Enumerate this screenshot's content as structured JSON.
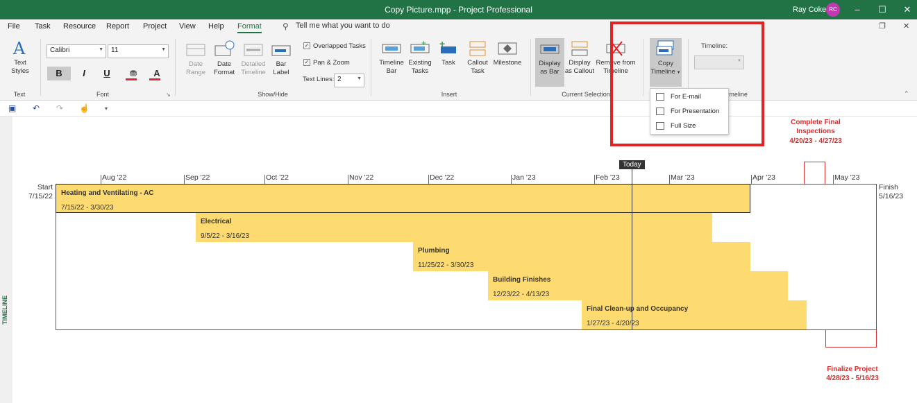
{
  "titlebar": {
    "title": "Copy Picture.mpp  -  Project Professional",
    "user": "Ray Coker",
    "avatar": "RC"
  },
  "menu": {
    "tabs": [
      "File",
      "Task",
      "Resource",
      "Report",
      "Project",
      "View",
      "Help",
      "Format"
    ],
    "active": "Format",
    "search": "Tell me what you want to do"
  },
  "ribbon": {
    "text_group": {
      "label": "Text",
      "text_styles": "Text\nStyles"
    },
    "font_group": {
      "label": "Font",
      "font": "Calibri",
      "size": "11",
      "bold": "B",
      "italic": "I",
      "underline": "U"
    },
    "showhide_group": {
      "label": "Show/Hide",
      "date_range": "Date\nRange",
      "date_format": "Date\nFormat",
      "detailed_timeline": "Detailed\nTimeline",
      "bar_label": "Bar\nLabel",
      "overlapped": "Overlapped Tasks",
      "pan_zoom": "Pan & Zoom",
      "text_lines_label": "Text Lines:",
      "text_lines_value": "2"
    },
    "insert_group": {
      "label": "Insert",
      "timeline_bar": "Timeline\nBar",
      "existing_tasks": "Existing\nTasks",
      "task": "Task",
      "callout_task": "Callout\nTask",
      "milestone": "Milestone"
    },
    "current_selection_group": {
      "label": "Current Selection",
      "display_bar": "Display\nas Bar",
      "display_callout": "Display\nas Callout",
      "remove": "Remove from\nTimeline"
    },
    "copy_group": {
      "copy_timeline": "Copy\nTimeline"
    },
    "timeline_group": {
      "label_top": "Timeline:",
      "label_bottom": "Timeline"
    }
  },
  "dropdown": {
    "items": [
      "For E-mail",
      "For Presentation",
      "Full Size"
    ]
  },
  "sidebar": {
    "label": "TIMELINE"
  },
  "timeline": {
    "start_label": "Start",
    "start_date": "7/15/22",
    "finish_label": "Finish",
    "finish_date": "5/16/23",
    "months": [
      "Aug '22",
      "Sep '22",
      "Oct '22",
      "Nov '22",
      "Dec '22",
      "Jan '23",
      "Feb '23",
      "Mar '23",
      "Apr '23",
      "May '23"
    ],
    "today": "Today",
    "bars": [
      {
        "name": "Heating and Ventilating - AC",
        "dates": "7/15/22 - 3/30/23"
      },
      {
        "name": "Electrical",
        "dates": "9/5/22 - 3/16/23"
      },
      {
        "name": "Plumbing",
        "dates": "11/25/22 - 3/30/23"
      },
      {
        "name": "Building Finishes",
        "dates": "12/23/22 - 4/13/23"
      },
      {
        "name": "Final Clean-up and Occupancy",
        "dates": "1/27/23 - 4/20/23"
      }
    ],
    "callouts": [
      {
        "name": "Complete Final\nInspections",
        "dates": "4/20/23 - 4/27/23"
      },
      {
        "name": "Finalize Project",
        "dates": "4/28/23 - 5/16/23"
      }
    ]
  },
  "colors": {
    "accent": "#217346",
    "bar": "#fedb70",
    "callout": "#d32f2f",
    "highlight": "#e02424"
  }
}
